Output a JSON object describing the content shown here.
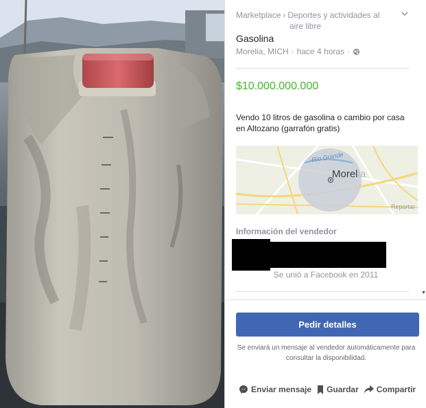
{
  "breadcrumb": {
    "root": "Marketplace",
    "separator": "›",
    "category": "Deportes y actividades al aire libre"
  },
  "listing": {
    "title": "Gasolina",
    "location": "Morelia, MICH",
    "dot": "·",
    "posted": "hace 4 horas",
    "price": "$10.000.000.000",
    "description": "Vendo 10 litros de gasolina o cambio por casa en Altozano (garrafón gratis)"
  },
  "map": {
    "city_main": "Morel",
    "city_tail": "ia",
    "river_label": "Río Grande",
    "report_label": "Reportar"
  },
  "seller": {
    "heading": "Información del vendedor",
    "joined": "Se unió a Facebook en 2011"
  },
  "cta": {
    "button_label": "Pedir detalles",
    "note": "Se enviará un mensaje al vendedor automáticamente para consultar la disponibilidad."
  },
  "actions": {
    "message": "Enviar mensaje",
    "save": "Guardar",
    "share": "Compartir"
  },
  "colors": {
    "price_green": "#42b72a",
    "button_blue": "#4267b2",
    "muted_text": "#90949c"
  },
  "icons": {
    "collapse": "chevron-down-icon",
    "privacy": "globe-icon",
    "messenger": "messenger-icon",
    "save": "bookmark-icon",
    "share": "share-arrow-icon"
  }
}
